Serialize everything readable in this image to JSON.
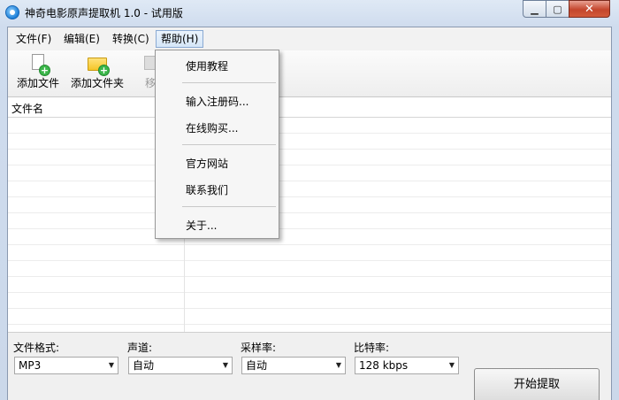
{
  "window": {
    "title": "神奇电影原声提取机 1.0 - 试用版",
    "controls": {
      "minimize": "▁",
      "maximize": "▢",
      "close": "✕"
    }
  },
  "menubar": {
    "items": [
      {
        "label": "文件(F)"
      },
      {
        "label": "编辑(E)"
      },
      {
        "label": "转换(C)"
      },
      {
        "label": "帮助(H)",
        "active": true
      }
    ]
  },
  "toolbar": {
    "items": [
      {
        "label": "添加文件",
        "icon": "add-file-icon"
      },
      {
        "label": "添加文件夹",
        "icon": "add-folder-icon"
      },
      {
        "label": "移",
        "icon": "move-icon"
      }
    ]
  },
  "file_list": {
    "columns": [
      "文件名"
    ],
    "rows": []
  },
  "help_menu": {
    "items": [
      "使用教程",
      "输入注册码...",
      "在线购买...",
      "官方网站",
      "联系我们",
      "关于..."
    ]
  },
  "options": {
    "format": {
      "label": "文件格式:",
      "value": "MP3"
    },
    "channel": {
      "label": "声道:",
      "value": "自动"
    },
    "samplerate": {
      "label": "采样率:",
      "value": "自动"
    },
    "bitrate": {
      "label": "比特率:",
      "value": "128 kbps"
    }
  },
  "start_button": {
    "label": "开始提取"
  },
  "colors": {
    "accent": "#3bb64a",
    "menu_highlight": "#d5e6f8",
    "close": "#c4462d"
  }
}
